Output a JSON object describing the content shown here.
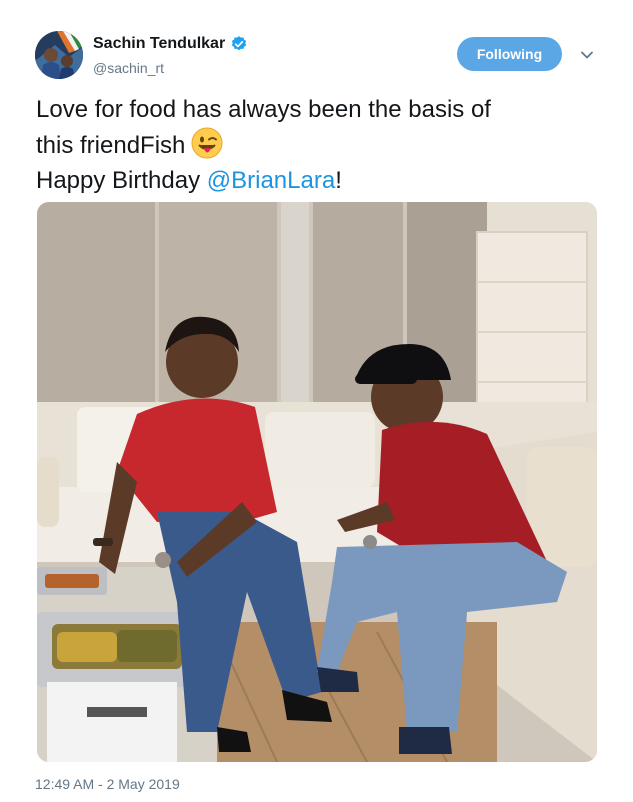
{
  "tweet": {
    "author": {
      "display_name": "Sachin Tendulkar",
      "handle": "@sachin_rt",
      "verified": true,
      "avatar": "profile-photo"
    },
    "follow_button": {
      "label": "Following"
    },
    "menu_icon": "chevron-down-icon",
    "text": {
      "line1": "Love for food has always been the basis of",
      "line2": "this friendFish",
      "emoji": "winking-face-with-tongue",
      "line3_prefix": "Happy Birthday ",
      "mention": "@BrianLara",
      "line3_suffix": "!"
    },
    "media": {
      "type": "photo",
      "description_icon": "photo"
    },
    "timestamp": "12:49 AM - 2 May 2019"
  },
  "colors": {
    "accent": "#1b95e0",
    "follow_button_bg": "#5ba7e6",
    "secondary_text": "#657786",
    "verified_badge": "#1da1f2"
  }
}
